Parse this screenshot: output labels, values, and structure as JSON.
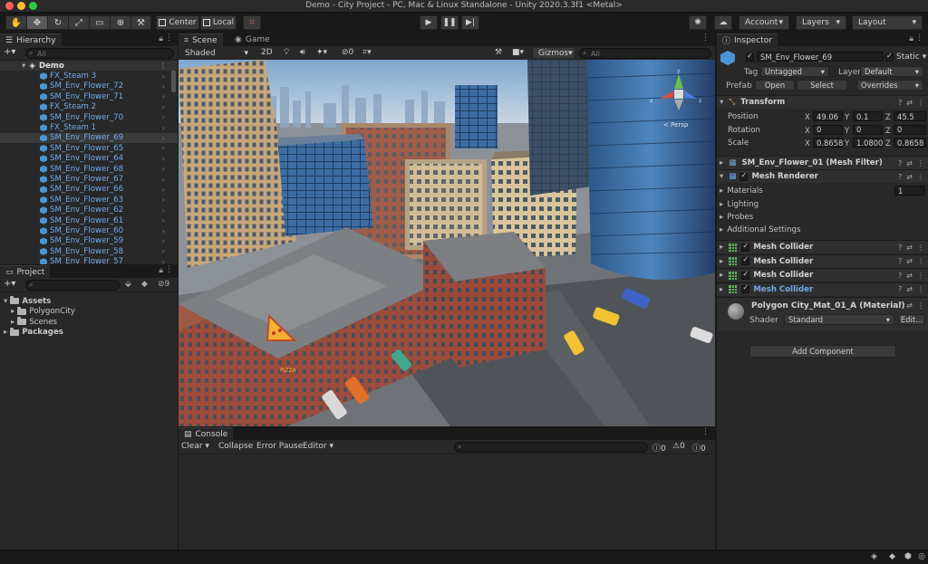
{
  "window": {
    "title": "Demo - City Project - PC, Mac & Linux Standalone - Unity 2020.3.3f1 <Metal>"
  },
  "toolbar": {
    "tools": [
      "hand-icon",
      "move-icon",
      "rotate-icon",
      "scale-icon",
      "rect-icon",
      "transform-icon",
      "custom-tool-icon"
    ],
    "pivot_label": "Center",
    "space_label": "Local",
    "account_label": "Account",
    "layers_label": "Layers",
    "layout_label": "Layout"
  },
  "hierarchy": {
    "tab_label": "Hierarchy",
    "search_placeholder": "All",
    "scene_name": "Demo",
    "items": [
      {
        "label": "FX_Steam 3"
      },
      {
        "label": "SM_Env_Flower_72"
      },
      {
        "label": "SM_Env_Flower_71"
      },
      {
        "label": "FX_Steam 2"
      },
      {
        "label": "SM_Env_Flower_70"
      },
      {
        "label": "FX_Steam 1"
      },
      {
        "label": "SM_Env_Flower_69"
      },
      {
        "label": "SM_Env_Flower_65"
      },
      {
        "label": "SM_Env_Flower_64"
      },
      {
        "label": "SM_Env_Flower_68"
      },
      {
        "label": "SM_Env_Flower_67"
      },
      {
        "label": "SM_Env_Flower_66"
      },
      {
        "label": "SM_Env_Flower_63"
      },
      {
        "label": "SM_Env_Flower_62"
      },
      {
        "label": "SM_Env_Flower_61"
      },
      {
        "label": "SM_Env_Flower_60"
      },
      {
        "label": "SM_Env_Flower_59"
      },
      {
        "label": "SM_Env_Flower_58"
      },
      {
        "label": "SM_Env_Flower_57"
      }
    ]
  },
  "project": {
    "tab_label": "Project",
    "hidden_count": "9",
    "assets_label": "Assets",
    "folders": [
      "PolygonCity",
      "Scenes"
    ],
    "packages_label": "Packages"
  },
  "scene": {
    "tab_scene": "Scene",
    "tab_game": "Game",
    "shading_mode": "Shaded",
    "mode_2d": "2D",
    "fx_count": "0",
    "gizmos_label": "Gizmos",
    "search_placeholder": "All",
    "persp_label": "< Persp",
    "pizza_sign": "PIZZA"
  },
  "console": {
    "tab_label": "Console",
    "clear_label": "Clear",
    "collapse_label": "Collapse",
    "error_pause_label": "Error Pause",
    "editor_label": "Editor",
    "info_count": "0",
    "warn_count": "0",
    "error_count": "0"
  },
  "inspector": {
    "tab_label": "Inspector",
    "object_name": "SM_Env_Flower_69",
    "static_label": "Static",
    "tag_label": "Tag",
    "tag_value": "Untagged",
    "layer_label": "Layer",
    "layer_value": "Default",
    "prefab_label": "Prefab",
    "open_label": "Open",
    "select_label": "Select",
    "overrides_label": "Overrides",
    "transform": {
      "title": "Transform",
      "position_label": "Position",
      "rotation_label": "Rotation",
      "scale_label": "Scale",
      "position": [
        "49.06",
        "0.1",
        "45.5"
      ],
      "rotation": [
        "0",
        "0",
        "0"
      ],
      "scale": [
        "0.8658",
        "1.0800",
        "0.8658"
      ]
    },
    "mesh_filter_title": "SM_Env_Flower_01 (Mesh Filter)",
    "mesh_renderer": {
      "title": "Mesh Renderer",
      "materials_label": "Materials",
      "materials_count": "1",
      "lighting_label": "Lighting",
      "probes_label": "Probes",
      "additional_label": "Additional Settings"
    },
    "colliders": [
      "Mesh Collider",
      "Mesh Collider",
      "Mesh Collider",
      "Mesh Collider"
    ],
    "material": {
      "title": "Polygon City_Mat_01_A (Material)",
      "shader_label": "Shader",
      "shader_value": "Standard",
      "edit_label": "Edit..."
    },
    "add_component_label": "Add Component"
  },
  "colors": {
    "accent_blue": "#74a9e6",
    "panel_bg": "#282828",
    "window_bg": "#191919"
  }
}
